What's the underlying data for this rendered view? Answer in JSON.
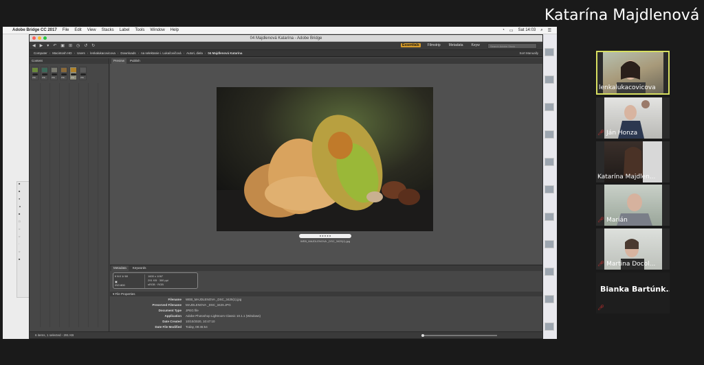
{
  "speaker": {
    "name": "Katarína Majdlenová"
  },
  "mac": {
    "app_name": "Adobe Bridge CC 2017",
    "menu": [
      "File",
      "Edit",
      "View",
      "Stacks",
      "Label",
      "Tools",
      "Window",
      "Help"
    ],
    "clock": "Sat 14:03"
  },
  "bridge": {
    "window_title": "04 Majdlenová Katarína - Adobe Bridge",
    "workspaces": [
      "Essentials",
      "Filmstrip",
      "Metadata",
      "Keyw"
    ],
    "search_placeholder": "Search Adobe Stock",
    "path": [
      "Computer",
      "Macintosh HD",
      "Users",
      "lenkalukacovicova",
      "Downloads",
      "na selektanie i. Lukačovičová",
      "Autori, diela",
      "04 Majdlenová Katarína"
    ],
    "sort_label": "Sort Manually",
    "content_tab": "Content",
    "preview_tabs": [
      "Preview",
      "Publish"
    ],
    "meta_tabs": [
      "Metadata",
      "Keywords"
    ],
    "exif": {
      "aperture": "f/ 8.0",
      "shutter": "1/ 60",
      "iso": "ISO 800",
      "dimensions": "1600 x 1067",
      "size": "291 KB",
      "ppi": "300 ppi",
      "color": "sRGB",
      "mode": "RGB"
    },
    "caption": "WEB_MAJDLENOVA _DSC_3425(1).jpg",
    "file_props_title": "File Properties",
    "props": [
      {
        "k": "Filename",
        "v": "WEB_MAJDLENOVA _DSC_3425(1).jpg"
      },
      {
        "k": "Preserved Filename",
        "v": "MAJDLENOVA _DSC_3426.JPG"
      },
      {
        "k": "Document Type",
        "v": "JPEG file"
      },
      {
        "k": "Application",
        "v": "Adobe Photoshop Lightroom Classic 10.1.1 (Windows)"
      },
      {
        "k": "Date Created",
        "v": "10/10/2020, 10:47:10"
      },
      {
        "k": "Date File Modified",
        "v": "Today, 08:45:54"
      }
    ],
    "thumbs": [
      {
        "badge": "2●",
        "label": "WE"
      },
      {
        "badge": "3●",
        "label": "WE"
      },
      {
        "badge": "5●",
        "label": "WE"
      },
      {
        "badge": "2●",
        "label": "WE"
      },
      {
        "badge": "3●",
        "label": "WE"
      },
      {
        "badge": "2●",
        "label": "WE"
      }
    ],
    "status": "6 items, 1 selected - 291 KB"
  },
  "participants": [
    {
      "name": "lenkalukacovicova",
      "muted": false,
      "active": true
    },
    {
      "name": "Ján Honza",
      "muted": true,
      "active": false
    },
    {
      "name": "Katarína Majdlen...",
      "muted": false,
      "active": false
    },
    {
      "name": "Marián",
      "muted": true,
      "active": false
    },
    {
      "name": "Martina Docol...",
      "muted": true,
      "active": false
    },
    {
      "name": "Bianka Bartúnk...",
      "muted": true,
      "active": false
    }
  ]
}
